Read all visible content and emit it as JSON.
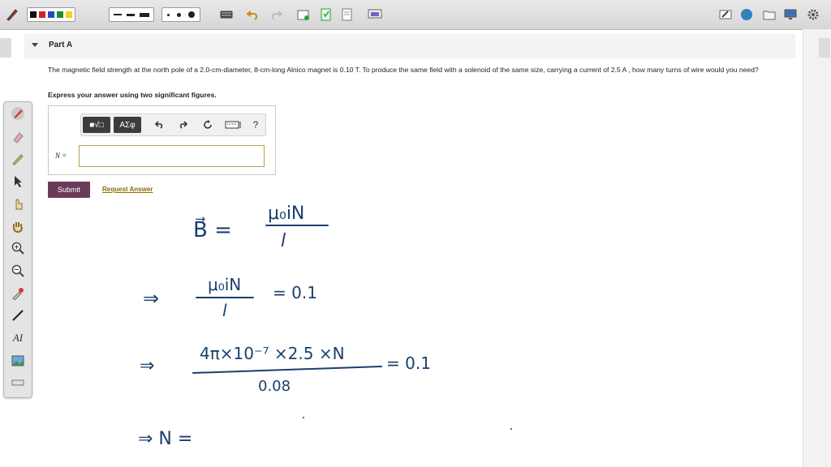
{
  "toolbar": {
    "icons": [
      "pen-icon",
      "undo-icon",
      "redo-icon",
      "new-page-icon",
      "copy-page-icon",
      "page-icon",
      "screen-icon",
      "edit-icon",
      "globe-icon",
      "folder-icon",
      "display-icon",
      "settings-icon"
    ],
    "colors": [
      "#111111",
      "#d6202a",
      "#1f4fb5",
      "#1a8f2d",
      "#f2d21a"
    ]
  },
  "part": {
    "title": "Part A"
  },
  "question": {
    "text": "The magnetic field strength at the north pole of a 2.0-cm-diameter, 8-cm-long Alnico magnet is 0.10 T. To produce the same field with a solenoid of the same size, carrying a current of 2.5 A , how many turns of wire would you need?",
    "instruction": "Express your answer using two significant figures."
  },
  "answer": {
    "label": "N =",
    "value": "",
    "math_buttons": {
      "templates": "■√□",
      "symbols": "ΑΣφ",
      "help": "?"
    }
  },
  "actions": {
    "submit": "Submit",
    "request_answer": "Request Answer"
  },
  "handwriting": {
    "line1_lhs": "B⃗ =",
    "line1_num": "μ₀iN",
    "line1_den": "l",
    "line2_arrow": "⇒",
    "line2_num": "μ₀iN",
    "line2_den": "l",
    "line2_rhs": "= 0.1",
    "line3_arrow": "⇒",
    "line3_num": "4π×10⁻⁷ ×2.5 ×N",
    "line3_den": "0.08",
    "line3_rhs": "= 0.1",
    "line4": "⇒   N ="
  }
}
